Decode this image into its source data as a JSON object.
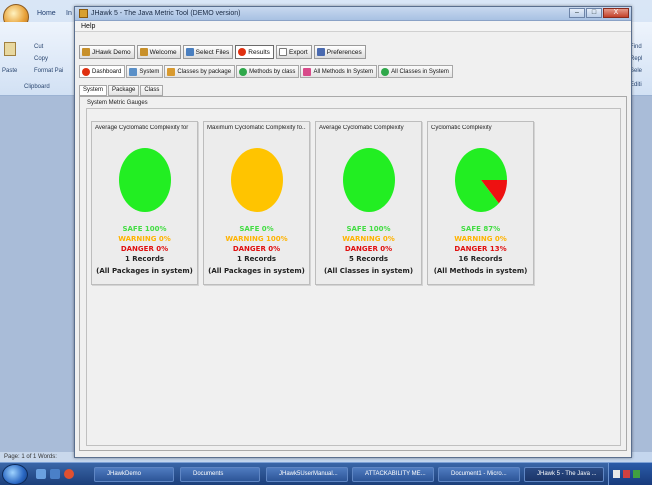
{
  "background_app": {
    "tabs": [
      "Home",
      "In"
    ],
    "clipboard": {
      "paste_label": "Paste",
      "cut_label": "Cut",
      "copy_label": "Copy",
      "format_label": "Format Pai",
      "group_label": "Clipboard"
    },
    "right_items": [
      "Find",
      "Repl",
      "Sele",
      "Editi"
    ],
    "status_text": "Page: 1 of 1   Words:"
  },
  "window": {
    "title": "JHawk 5 - The Java Metric Tool (DEMO version)",
    "controls": {
      "minimize": "–",
      "maximize": "□",
      "close": "X"
    }
  },
  "menu": {
    "help": "Help"
  },
  "toolbar": {
    "buttons": [
      {
        "label": "JHawk Demo",
        "icon": "jhawk-icon",
        "color": "#c8902a"
      },
      {
        "label": "Welcome",
        "icon": "welcome-icon",
        "color": "#c8902a"
      },
      {
        "label": "Select Files",
        "icon": "folder-icon",
        "color": "#4a7fc0"
      },
      {
        "label": "Results",
        "icon": "results-icon",
        "color": "#e03010"
      },
      {
        "label": "Export",
        "icon": "export-icon",
        "color": "#7a7a7a"
      },
      {
        "label": "Preferences",
        "icon": "wrench-icon",
        "color": "#4a6ab0"
      }
    ],
    "active": "Results"
  },
  "result_tabs": [
    {
      "label": "Dashboard",
      "icon": "dashboard-icon",
      "color": "#e03010"
    },
    {
      "label": "System",
      "icon": "system-icon",
      "color": "#5a90c8"
    },
    {
      "label": "Classes by package",
      "icon": "package-icon",
      "color": "#d89a30"
    },
    {
      "label": "Methods by class",
      "icon": "methods-icon",
      "color": "#2fa84a"
    },
    {
      "label": "All Methods In System",
      "icon": "all-methods-icon",
      "color": "#d84a8a"
    },
    {
      "label": "All Classes in System",
      "icon": "all-classes-icon",
      "color": "#2fa84a"
    }
  ],
  "inner_tabs": [
    "System",
    "Package",
    "Class"
  ],
  "group_title": "System Metric Gauges",
  "gauges": [
    {
      "title": "Average Cyclomatic Complexity for",
      "safe": "SAFE 100%",
      "warning": "WARNING 0%",
      "danger": "DANGER 0%",
      "records": "1 Records",
      "scope": "(All Packages in system)",
      "pie": {
        "safe": 100,
        "warning": 0,
        "danger": 0
      }
    },
    {
      "title": "Maximum Cyclomatic Complexity fo...",
      "safe": "SAFE 0%",
      "warning": "WARNING 100%",
      "danger": "DANGER 0%",
      "records": "1 Records",
      "scope": "(All Packages in system)",
      "pie": {
        "safe": 0,
        "warning": 100,
        "danger": 0
      }
    },
    {
      "title": "Average Cyclomatic Complexity",
      "safe": "SAFE 100%",
      "warning": "WARNING 0%",
      "danger": "DANGER 0%",
      "records": "5 Records",
      "scope": "(All Classes in system)",
      "pie": {
        "safe": 100,
        "warning": 0,
        "danger": 0
      }
    },
    {
      "title": "Cyclomatic Complexity",
      "safe": "SAFE 87%",
      "warning": "WARNING 0%",
      "danger": "DANGER 13%",
      "records": "16 Records",
      "scope": "(All Methods in system)",
      "pie": {
        "safe": 87,
        "warning": 0,
        "danger": 13
      }
    }
  ],
  "colors": {
    "safe": "#22ee22",
    "warning": "#ffc400",
    "danger": "#ee1111"
  },
  "taskbar": {
    "items": [
      "JHawkDemo",
      "Documents",
      "JHawk5UserManual...",
      "ATTACKABILITY ME...",
      "Document1 - Micro...",
      "JHawk 5 - The Java ..."
    ],
    "active": "JHawk 5 - The Java ..."
  }
}
